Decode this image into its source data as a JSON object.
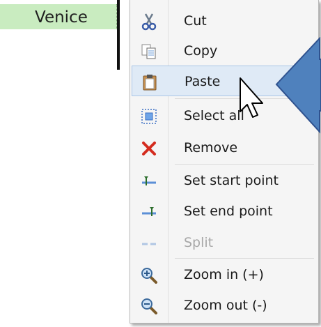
{
  "cell": {
    "text": "Venice"
  },
  "menu": {
    "items": [
      {
        "label": "Cut",
        "icon": "scissors-icon",
        "enabled": true
      },
      {
        "label": "Copy",
        "icon": "copy-icon",
        "enabled": true
      },
      {
        "label": "Paste",
        "icon": "clipboard-icon",
        "enabled": true,
        "highlighted": true
      },
      {
        "label": "Select all",
        "icon": "select-all-icon",
        "enabled": true
      },
      {
        "label": "Remove",
        "icon": "red-x-icon",
        "enabled": true
      },
      {
        "label": "Set start point",
        "icon": "start-point-icon",
        "enabled": true
      },
      {
        "label": "Set end point",
        "icon": "end-point-icon",
        "enabled": true
      },
      {
        "label": "Split",
        "icon": "split-icon",
        "enabled": false
      },
      {
        "label": "Zoom in (+)",
        "icon": "zoom-in-icon",
        "enabled": true
      },
      {
        "label": "Zoom out (-)",
        "icon": "zoom-out-icon",
        "enabled": true
      }
    ]
  },
  "colors": {
    "cell_background": "#c9ecc0",
    "highlight_background": "#dfeaf6",
    "arrow_fill": "#4f81bd"
  }
}
